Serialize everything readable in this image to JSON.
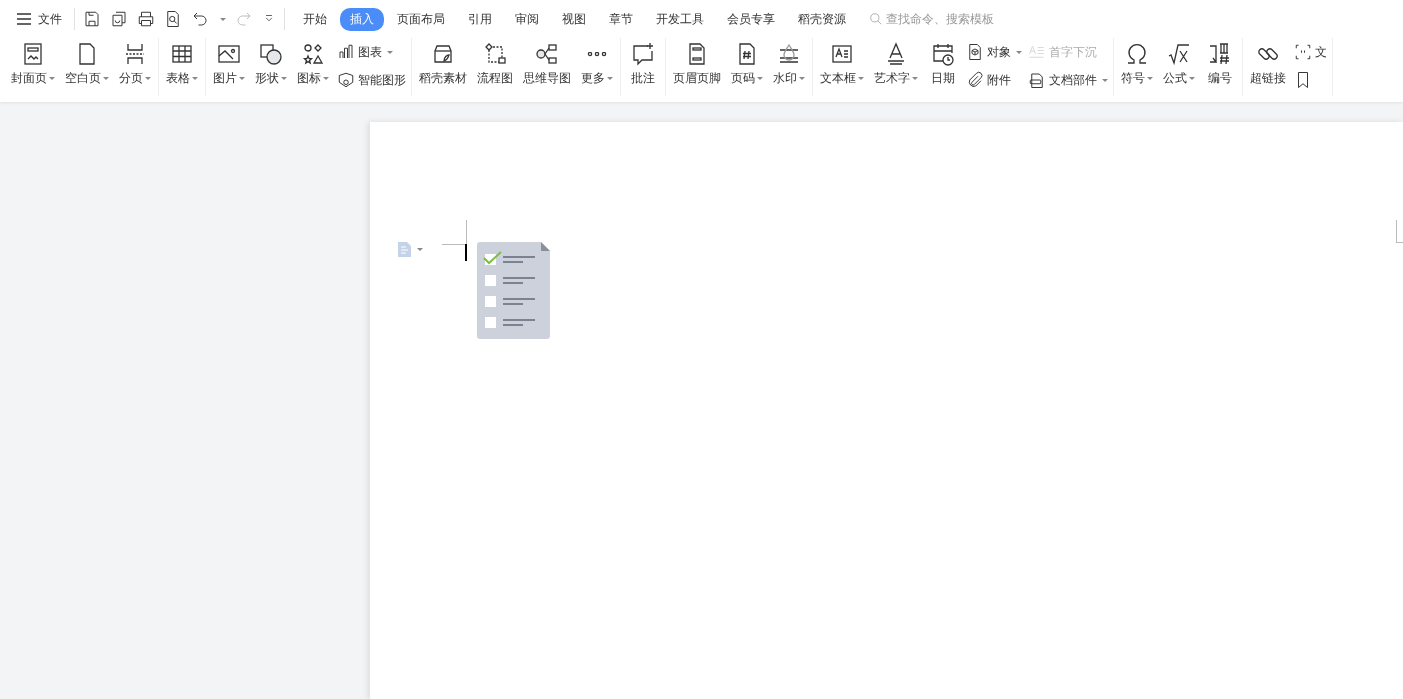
{
  "menu": {
    "label": "文件"
  },
  "tabs": [
    {
      "label": "开始",
      "selected": false
    },
    {
      "label": "插入",
      "selected": true
    },
    {
      "label": "页面布局",
      "selected": false
    },
    {
      "label": "引用",
      "selected": false
    },
    {
      "label": "审阅",
      "selected": false
    },
    {
      "label": "视图",
      "selected": false
    },
    {
      "label": "章节",
      "selected": false
    },
    {
      "label": "开发工具",
      "selected": false
    },
    {
      "label": "会员专享",
      "selected": false
    },
    {
      "label": "稻壳资源",
      "selected": false
    }
  ],
  "search": {
    "placeholder": "查找命令、搜索模板"
  },
  "ribbon": [
    {
      "items": [
        {
          "kind": "large",
          "label": "封面页",
          "dropdown": true
        },
        {
          "kind": "large",
          "label": "空白页",
          "dropdown": true
        },
        {
          "kind": "large",
          "label": "分页",
          "dropdown": true
        }
      ]
    },
    {
      "items": [
        {
          "kind": "large",
          "label": "表格",
          "dropdown": true
        }
      ]
    },
    {
      "items": [
        {
          "kind": "large",
          "label": "图片",
          "dropdown": true
        },
        {
          "kind": "large",
          "label": "形状",
          "dropdown": true
        },
        {
          "kind": "large",
          "label": "图标",
          "dropdown": true
        },
        {
          "kind": "stack",
          "rows": [
            {
              "label": "图表",
              "dropdown": true,
              "disabled": false
            },
            {
              "label": "智能图形",
              "dropdown": false,
              "disabled": false
            }
          ]
        }
      ]
    },
    {
      "items": [
        {
          "kind": "large",
          "label": "稻壳素材",
          "dropdown": false
        },
        {
          "kind": "large",
          "label": "流程图",
          "dropdown": false
        },
        {
          "kind": "large",
          "label": "思维导图",
          "dropdown": false
        },
        {
          "kind": "large",
          "label": "更多",
          "dropdown": true
        }
      ]
    },
    {
      "items": [
        {
          "kind": "large",
          "label": "批注",
          "dropdown": false
        }
      ]
    },
    {
      "items": [
        {
          "kind": "large",
          "label": "页眉页脚",
          "dropdown": false
        },
        {
          "kind": "large",
          "label": "页码",
          "dropdown": true
        },
        {
          "kind": "large",
          "label": "水印",
          "dropdown": true
        }
      ]
    },
    {
      "items": [
        {
          "kind": "large",
          "label": "文本框",
          "dropdown": true
        },
        {
          "kind": "large",
          "label": "艺术字",
          "dropdown": true
        },
        {
          "kind": "large",
          "label": "日期",
          "dropdown": false
        },
        {
          "kind": "stack",
          "rows": [
            {
              "label": "对象",
              "dropdown": true,
              "disabled": false
            },
            {
              "label": "附件",
              "dropdown": false,
              "disabled": false
            }
          ]
        },
        {
          "kind": "stack",
          "rows": [
            {
              "label": "首字下沉",
              "dropdown": false,
              "disabled": true
            },
            {
              "label": "文档部件",
              "dropdown": true,
              "disabled": false
            }
          ]
        }
      ]
    },
    {
      "items": [
        {
          "kind": "large",
          "label": "符号",
          "dropdown": true
        },
        {
          "kind": "large",
          "label": "公式",
          "dropdown": true
        },
        {
          "kind": "large",
          "label": "编号",
          "dropdown": false
        }
      ]
    },
    {
      "items": [
        {
          "kind": "large",
          "label": "超链接",
          "dropdown": false
        },
        {
          "kind": "stack",
          "rows": [
            {
              "label": "文",
              "dropdown": false,
              "disabled": false
            },
            {
              "dropdown": false,
              "disabled": false
            }
          ]
        }
      ]
    }
  ]
}
